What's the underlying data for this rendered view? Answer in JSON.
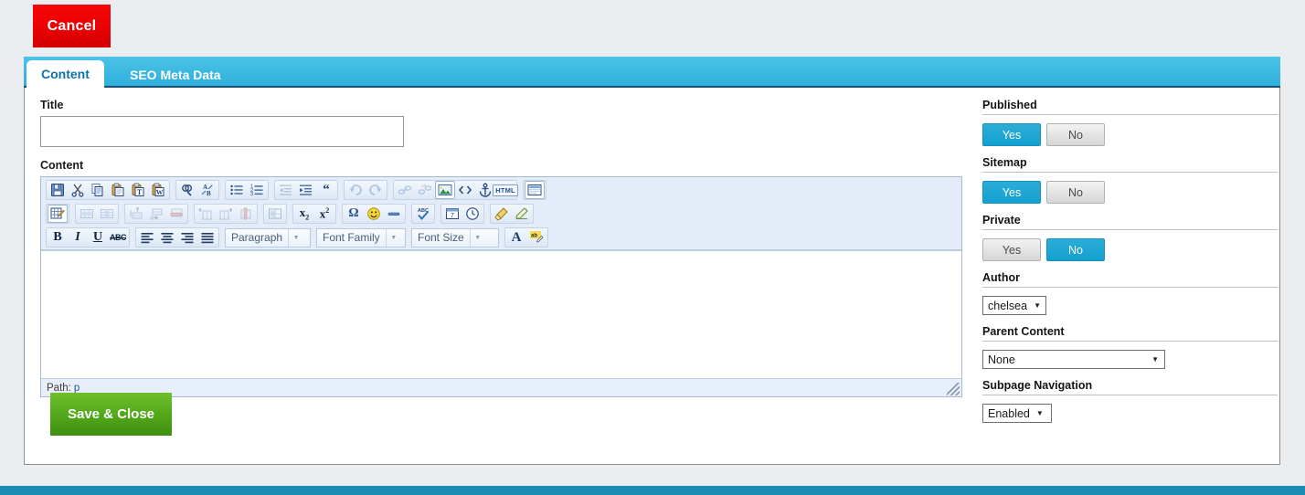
{
  "top_actions": {
    "cancel_label": "Cancel"
  },
  "tabs": [
    {
      "label": "Content",
      "active": true
    },
    {
      "label": "SEO Meta Data",
      "active": false
    }
  ],
  "form": {
    "title_label": "Title",
    "title_value": "",
    "title_placeholder": "",
    "content_label": "Content",
    "save_label": "Save & Close"
  },
  "editor": {
    "status_path_label": "Path:",
    "status_path_value": "p",
    "body_text": "",
    "selects": {
      "paragraph": "Paragraph",
      "font_family": "Font Family",
      "font_size": "Font Size"
    },
    "toolbar_row1": [
      {
        "name": "save-icon",
        "title": "Save",
        "disabled": false
      },
      {
        "name": "cut-icon",
        "title": "Cut",
        "disabled": false
      },
      {
        "name": "copy-icon",
        "title": "Copy",
        "disabled": false
      },
      {
        "name": "paste-icon",
        "title": "Paste",
        "disabled": false
      },
      {
        "name": "paste-as-text-icon",
        "title": "Paste as Plain Text",
        "disabled": false
      },
      {
        "name": "paste-from-word-icon",
        "title": "Paste from Word",
        "disabled": false
      },
      {
        "name": "search-icon",
        "title": "Find",
        "disabled": false
      },
      {
        "name": "replace-icon",
        "title": "Find/Replace",
        "disabled": false
      },
      {
        "name": "bullet-list-icon",
        "title": "Unordered list",
        "disabled": false
      },
      {
        "name": "numbered-list-icon",
        "title": "Ordered list",
        "disabled": false
      },
      {
        "name": "outdent-icon",
        "title": "Outdent",
        "disabled": true
      },
      {
        "name": "indent-icon",
        "title": "Indent",
        "disabled": false
      },
      {
        "name": "blockquote-icon",
        "title": "Blockquote",
        "disabled": false
      },
      {
        "name": "undo-icon",
        "title": "Undo",
        "disabled": true
      },
      {
        "name": "redo-icon",
        "title": "Redo",
        "disabled": true
      },
      {
        "name": "link-icon",
        "title": "Insert link",
        "disabled": true
      },
      {
        "name": "unlink-icon",
        "title": "Unlink",
        "disabled": true
      },
      {
        "name": "image-icon",
        "title": "Insert image",
        "disabled": false
      },
      {
        "name": "source-code-icon",
        "title": "Edit HTML source",
        "disabled": false
      },
      {
        "name": "anchor-icon",
        "title": "Insert anchor",
        "disabled": false
      },
      {
        "name": "html-icon",
        "title": "HTML",
        "disabled": false
      },
      {
        "name": "fullscreen-icon",
        "title": "Fullscreen",
        "disabled": false
      }
    ],
    "toolbar_row2": [
      {
        "name": "table-icon",
        "title": "Insert table",
        "disabled": false
      },
      {
        "name": "table-row-props-icon",
        "title": "Table row properties",
        "disabled": true
      },
      {
        "name": "table-cell-props-icon",
        "title": "Table cell properties",
        "disabled": true
      },
      {
        "name": "row-insert-before-icon",
        "title": "Insert row before",
        "disabled": true
      },
      {
        "name": "row-insert-after-icon",
        "title": "Insert row after",
        "disabled": true
      },
      {
        "name": "row-delete-icon",
        "title": "Delete row",
        "disabled": true
      },
      {
        "name": "col-insert-before-icon",
        "title": "Insert column before",
        "disabled": true
      },
      {
        "name": "col-insert-after-icon",
        "title": "Insert column after",
        "disabled": true
      },
      {
        "name": "col-delete-icon",
        "title": "Delete column",
        "disabled": true
      },
      {
        "name": "split-merge-cells-icon",
        "title": "Split/merge cells",
        "disabled": true
      },
      {
        "name": "subscript-icon",
        "title": "Subscript",
        "disabled": false
      },
      {
        "name": "superscript-icon",
        "title": "Superscript",
        "disabled": false
      },
      {
        "name": "special-character-icon",
        "title": "Insert special character",
        "disabled": false
      },
      {
        "name": "emoticon-icon",
        "title": "Insert emoticon",
        "disabled": false
      },
      {
        "name": "horizontal-rule-icon",
        "title": "Insert horizontal rule",
        "disabled": false
      },
      {
        "name": "spellcheck-icon",
        "title": "Spellcheck",
        "disabled": false
      },
      {
        "name": "insert-date-icon",
        "title": "Insert date",
        "disabled": false
      },
      {
        "name": "insert-time-icon",
        "title": "Insert time",
        "disabled": false
      },
      {
        "name": "cleanup-icon",
        "title": "Cleanup messy code",
        "disabled": false
      },
      {
        "name": "remove-formatting-icon",
        "title": "Remove formatting",
        "disabled": false
      }
    ],
    "toolbar_row3": [
      {
        "name": "bold-icon",
        "title": "Bold",
        "disabled": false
      },
      {
        "name": "italic-icon",
        "title": "Italic",
        "disabled": false
      },
      {
        "name": "underline-icon",
        "title": "Underline",
        "disabled": false
      },
      {
        "name": "strikethrough-icon",
        "title": "Strikethrough",
        "disabled": false
      },
      {
        "name": "align-left-icon",
        "title": "Align left",
        "disabled": false
      },
      {
        "name": "align-center-icon",
        "title": "Align center",
        "disabled": false
      },
      {
        "name": "align-right-icon",
        "title": "Align right",
        "disabled": false
      },
      {
        "name": "align-justify-icon",
        "title": "Align full",
        "disabled": false
      },
      {
        "name": "text-color-icon",
        "title": "Text color",
        "disabled": false
      },
      {
        "name": "background-color-icon",
        "title": "Background color",
        "disabled": false
      }
    ]
  },
  "sidebar": {
    "published": {
      "label": "Published",
      "options": [
        "Yes",
        "No"
      ],
      "selected": "Yes"
    },
    "sitemap": {
      "label": "Sitemap",
      "options": [
        "Yes",
        "No"
      ],
      "selected": "Yes"
    },
    "private": {
      "label": "Private",
      "options": [
        "Yes",
        "No"
      ],
      "selected": "No"
    },
    "author": {
      "label": "Author",
      "value": "chelsea"
    },
    "parent_content": {
      "label": "Parent Content",
      "value": "None"
    },
    "subpage_navigation": {
      "label": "Subpage Navigation",
      "value": "Enabled"
    }
  },
  "colors": {
    "accent_blue": "#2CB0DB",
    "tab_bar": "#3bb8e0",
    "cancel_red": "#ee0204",
    "save_green": "#54a91c",
    "footer_teal": "#1b8cb3",
    "page_bg": "#eaeef0"
  }
}
